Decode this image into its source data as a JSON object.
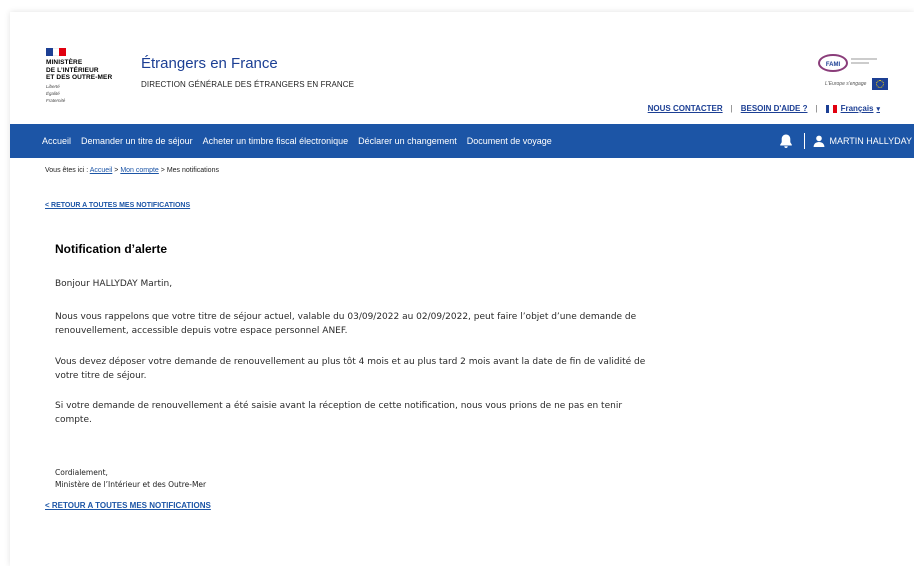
{
  "header": {
    "ministry_lines": [
      "MINISTÈRE",
      "DE L’INTÉRIEUR",
      "ET DES OUTRE-MER"
    ],
    "ministry_devise": [
      "Liberté",
      "Égalité",
      "Fraternité"
    ],
    "site_title": "Étrangers en France",
    "site_subtitle": "DIRECTION GÉNÉRALE DES ÉTRANGERS EN FRANCE",
    "fami_label": "FAMI",
    "fami_tagline": "L'Europe s'engage",
    "top_links": {
      "contact": "NOUS CONTACTER",
      "help": "BESOIN D'AIDE ?",
      "language": "Français"
    },
    "colors": {
      "flag_blue": "#1c3f94",
      "flag_red": "#e1000f"
    }
  },
  "nav": {
    "items": [
      "Accueil",
      "Demander un titre de séjour",
      "Acheter un timbre fiscal électronique",
      "Déclarer un changement",
      "Document de voyage"
    ],
    "user_name": "MARTIN HALLYDAY",
    "icons": [
      "bell-icon",
      "user-icon"
    ],
    "background_color": "#1c55a6"
  },
  "breadcrumb": {
    "prefix": "Vous êtes ici : ",
    "home": "Accueil",
    "sep1": " > ",
    "account": "Mon compte",
    "sep2": " > ",
    "current": "Mes notifications"
  },
  "back_link_top": "< RETOUR A TOUTES MES NOTIFICATIONS",
  "back_link_bottom": "< RETOUR A TOUTES MES NOTIFICATIONS",
  "notification": {
    "title": "Notification d’alerte",
    "greeting": "Bonjour HALLYDAY Martin,",
    "paragraphs": [
      "Nous vous rappelons que votre titre de séjour actuel, valable du 03/09/2022 au 02/09/2022, peut faire l’objet d’une demande de renouvellement, accessible depuis votre espace personnel ANEF.",
      "Vous devez déposer votre demande de renouvellement au plus tôt 4 mois et au plus tard 2 mois avant la date de fin de validité de votre titre de séjour.",
      "Si votre demande de renouvellement a été saisie avant la réception de cette notification, nous vous prions de ne pas en tenir compte."
    ],
    "closing": "Cordialement,",
    "signature": "Ministère de l’Intérieur et des Outre-Mer"
  }
}
